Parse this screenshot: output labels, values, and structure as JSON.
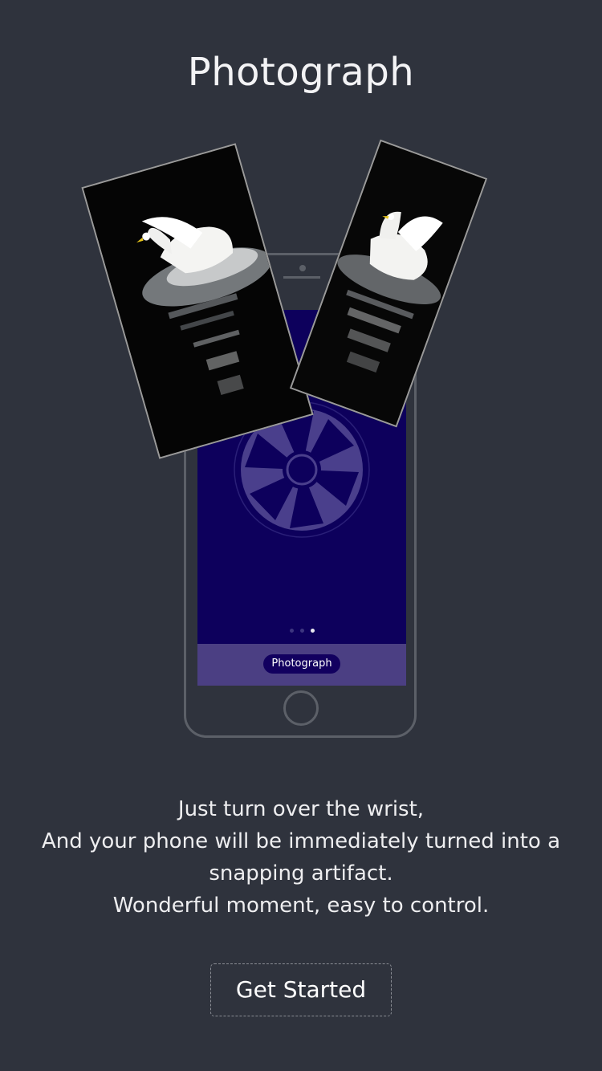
{
  "header": {
    "title": "Photograph"
  },
  "phone": {
    "screen_button_label": "Photograph",
    "page_indicator": {
      "count": 3,
      "active_index": 2
    },
    "shutter_icon": "camera-shutter-icon"
  },
  "photos": [
    {
      "icon": "swan-photo",
      "subject": "swan"
    },
    {
      "icon": "swan-photo",
      "subject": "swan"
    }
  ],
  "description": {
    "line1": "Just turn over the wrist,",
    "line2": "And your phone will be immediately turned into a",
    "line3": "snapping artifact.",
    "line4": "Wonderful moment, easy to control."
  },
  "cta": {
    "label": "Get Started"
  },
  "colors": {
    "background": "#2f333d",
    "screen": "#0d005c",
    "screen_footer": "#4b3f83",
    "pill": "#12005f"
  }
}
